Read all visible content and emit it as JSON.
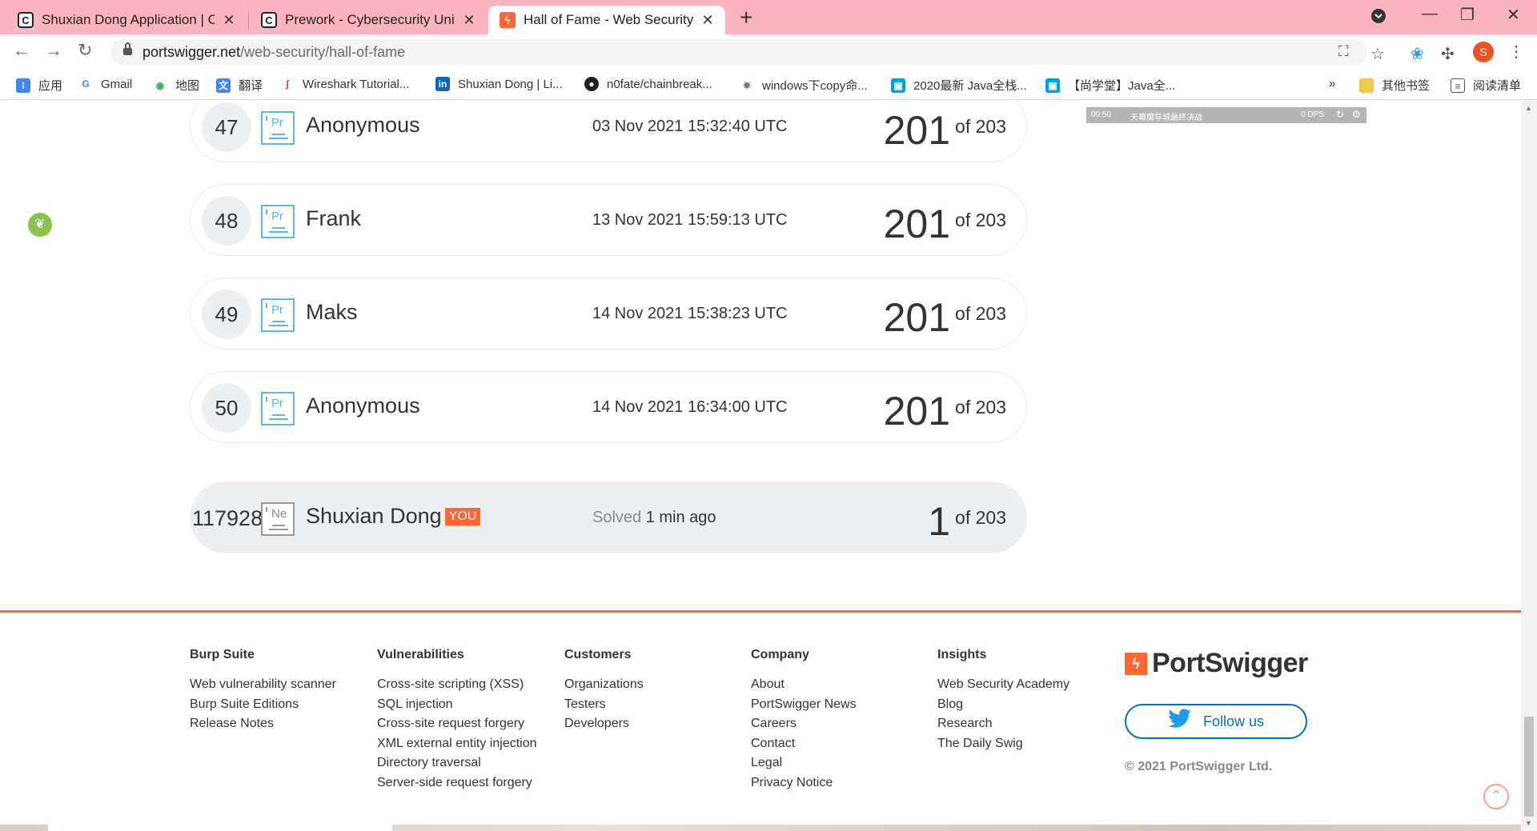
{
  "tabs": [
    {
      "title": "Shuxian Dong Application | Cy",
      "favicon": "c-icon",
      "active": false
    },
    {
      "title": "Prework - Cybersecurity Unive",
      "favicon": "c-icon",
      "active": false
    },
    {
      "title": "Hall of Fame - Web Security A",
      "favicon": "portswigger-icon",
      "active": true
    }
  ],
  "address": {
    "host": "portswigger.net",
    "path": "/web-security/hall-of-fame"
  },
  "profile_initial": "S",
  "bookmarks": [
    {
      "label": "应用",
      "icon": "apps-grid-icon",
      "color": "#4285f4"
    },
    {
      "label": "Gmail",
      "icon": "google-icon",
      "color": "#4285f4"
    },
    {
      "label": "地图",
      "icon": "maps-pin-icon",
      "color": "#34a853"
    },
    {
      "label": "翻译",
      "icon": "translate-icon",
      "color": "#4285f4"
    },
    {
      "label": "Wireshark Tutorial...",
      "icon": "wireshark-icon",
      "color": "#e53935"
    },
    {
      "label": "Shuxian Dong | Li...",
      "icon": "linkedin-icon",
      "color": "#0a66c2"
    },
    {
      "label": "n0fate/chainbreak...",
      "icon": "github-icon",
      "color": "#222222"
    },
    {
      "label": "windows下copy命...",
      "icon": "bug-icon",
      "color": "#777777"
    },
    {
      "label": "2020最新 Java全栈...",
      "icon": "bilibili-icon",
      "color": "#00a1d6"
    },
    {
      "label": "【尚学堂】Java全...",
      "icon": "bilibili-icon",
      "color": "#00a1d6"
    },
    {
      "label": "其他书签",
      "icon": "folder-icon",
      "color": "#f6c744"
    },
    {
      "label": "阅读清单",
      "icon": "reading-list-icon",
      "color": "#555555"
    }
  ],
  "bookmarks_overflow": "»",
  "video_bar": {
    "time": "00:50",
    "title": "天幕魔导城最终决战",
    "dps": "0 DPS"
  },
  "leaderboard": [
    {
      "rank": "47",
      "badge": "Pr",
      "name": "Anonymous",
      "date": "03 Nov 2021 15:32:40 UTC",
      "score": "201",
      "total": "of 203"
    },
    {
      "rank": "48",
      "badge": "Pr",
      "name": "Frank",
      "date": "13 Nov 2021 15:59:13 UTC",
      "score": "201",
      "total": "of 203"
    },
    {
      "rank": "49",
      "badge": "Pr",
      "name": "Maks",
      "date": "14 Nov 2021 15:38:23 UTC",
      "score": "201",
      "total": "of 203"
    },
    {
      "rank": "50",
      "badge": "Pr",
      "name": "Anonymous",
      "date": "14 Nov 2021 16:34:00 UTC",
      "score": "201",
      "total": "of 203"
    }
  ],
  "me": {
    "rank": "117928",
    "badge": "Ne",
    "name": "Shuxian Dong",
    "you_label": "YOU",
    "solved_label": "Solved",
    "solved_ago": "1 min ago",
    "score": "1",
    "total": "of 203"
  },
  "footer": {
    "columns": [
      {
        "heading": "Burp Suite",
        "links": [
          "Web vulnerability scanner",
          "Burp Suite Editions",
          "Release Notes"
        ]
      },
      {
        "heading": "Vulnerabilities",
        "links": [
          "Cross-site scripting (XSS)",
          "SQL injection",
          "Cross-site request forgery",
          "XML external entity injection",
          "Directory traversal",
          "Server-side request forgery"
        ]
      },
      {
        "heading": "Customers",
        "links": [
          "Organizations",
          "Testers",
          "Developers"
        ]
      },
      {
        "heading": "Company",
        "links": [
          "About",
          "PortSwigger News",
          "Careers",
          "Contact",
          "Legal",
          "Privacy Notice"
        ]
      },
      {
        "heading": "Insights",
        "links": [
          "Web Security Academy",
          "Blog",
          "Research",
          "The Daily Swig"
        ]
      }
    ],
    "brand": "PortSwigger",
    "follow_label": "Follow us",
    "copyright": "© 2021 PortSwigger Ltd."
  },
  "colors": {
    "accent": "#ff6633",
    "tabbar": "#f9b4bf",
    "badge": "#5eb6e6",
    "twitter": "#1d9bf0"
  }
}
